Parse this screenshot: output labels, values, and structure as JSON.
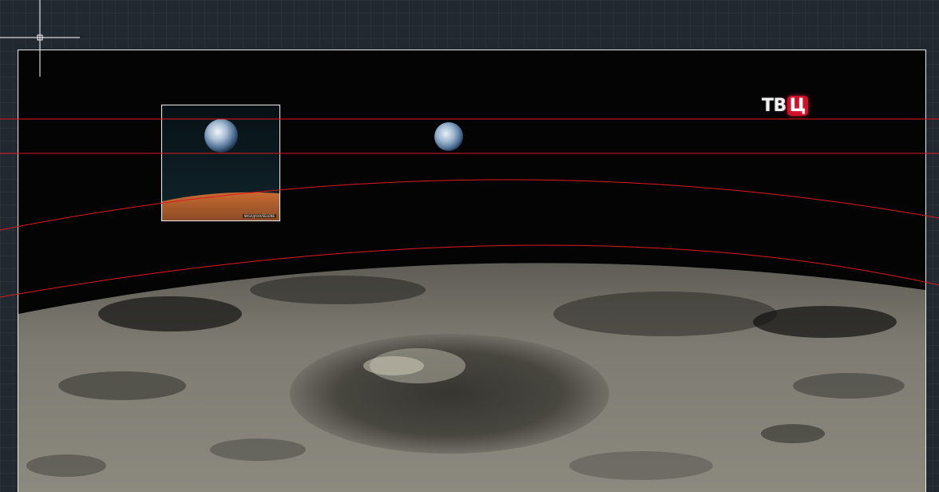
{
  "logo": {
    "main_text": "ТВ",
    "tail_text": "Ц",
    "name": "tvc-logo"
  },
  "inset": {
    "credit_text": "NASA/JAXA/SELENE"
  },
  "colors": {
    "background": "#212830",
    "frame_border": "#e8e8e8",
    "guide_line": "#e0191c",
    "space": "#040404",
    "moon_surface": "#7d7b70",
    "logo_accent": "#d0102a"
  },
  "icons": {
    "crosshair": "crosshair-cursor-icon"
  }
}
